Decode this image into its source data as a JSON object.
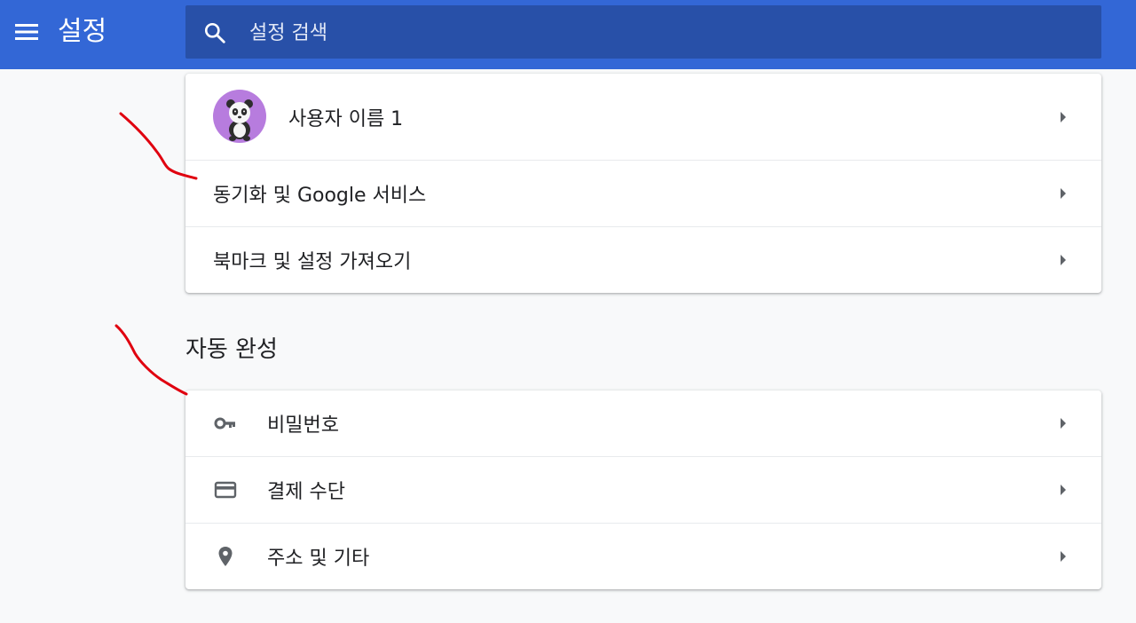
{
  "header": {
    "title": "설정",
    "menu_icon": "hamburger-menu-icon",
    "search": {
      "placeholder": "설정 검색",
      "value": "",
      "icon": "search-icon"
    },
    "color": "#3367d6",
    "search_bg": "#2850a8"
  },
  "people": {
    "items": [
      {
        "label": "사용자 이름 1",
        "icon": "avatar"
      },
      {
        "label": "동기화 및 Google 서비스"
      },
      {
        "label": "북마크 및 설정 가져오기"
      }
    ]
  },
  "autofill": {
    "title": "자동 완성",
    "items": [
      {
        "label": "비밀번호",
        "icon": "key-icon"
      },
      {
        "label": "결제 수단",
        "icon": "credit-card-icon"
      },
      {
        "label": "주소 및 기타",
        "icon": "location-pin-icon"
      }
    ]
  },
  "annotation_color": "#e0000f"
}
